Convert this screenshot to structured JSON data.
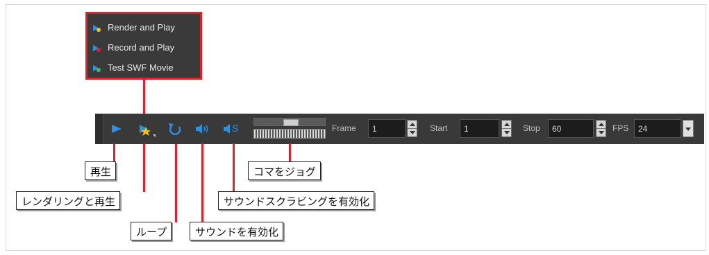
{
  "menu": {
    "items": [
      {
        "label": "Render and Play",
        "icon": "render-play-icon"
      },
      {
        "label": "Record and Play",
        "icon": "record-play-icon"
      },
      {
        "label": "Test SWF Movie",
        "icon": "swf-movie-icon"
      }
    ]
  },
  "toolbar": {
    "buttons": [
      {
        "icon": "play-icon"
      },
      {
        "icon": "render-and-play-icon"
      },
      {
        "icon": "loop-icon"
      },
      {
        "icon": "sound-icon"
      },
      {
        "icon": "sound-scrub-icon"
      }
    ],
    "sound_scrub_letter": "S",
    "frame": {
      "label": "Frame",
      "value": "1"
    },
    "start": {
      "label": "Start",
      "value": "1"
    },
    "stop": {
      "label": "Stop",
      "value": "60"
    },
    "fps": {
      "label": "FPS",
      "value": "24"
    }
  },
  "callouts": {
    "play": "再生",
    "render_play": "レンダリングと再生",
    "loop": "ループ",
    "sound": "サウンドを有効化",
    "jog": "コマをジョグ",
    "sound_scrub": "サウンドスクラビングを有効化"
  },
  "colors": {
    "highlight": "#e0202a",
    "toolbar_bg": "#393939",
    "icon_blue": "#2f8fe0"
  }
}
